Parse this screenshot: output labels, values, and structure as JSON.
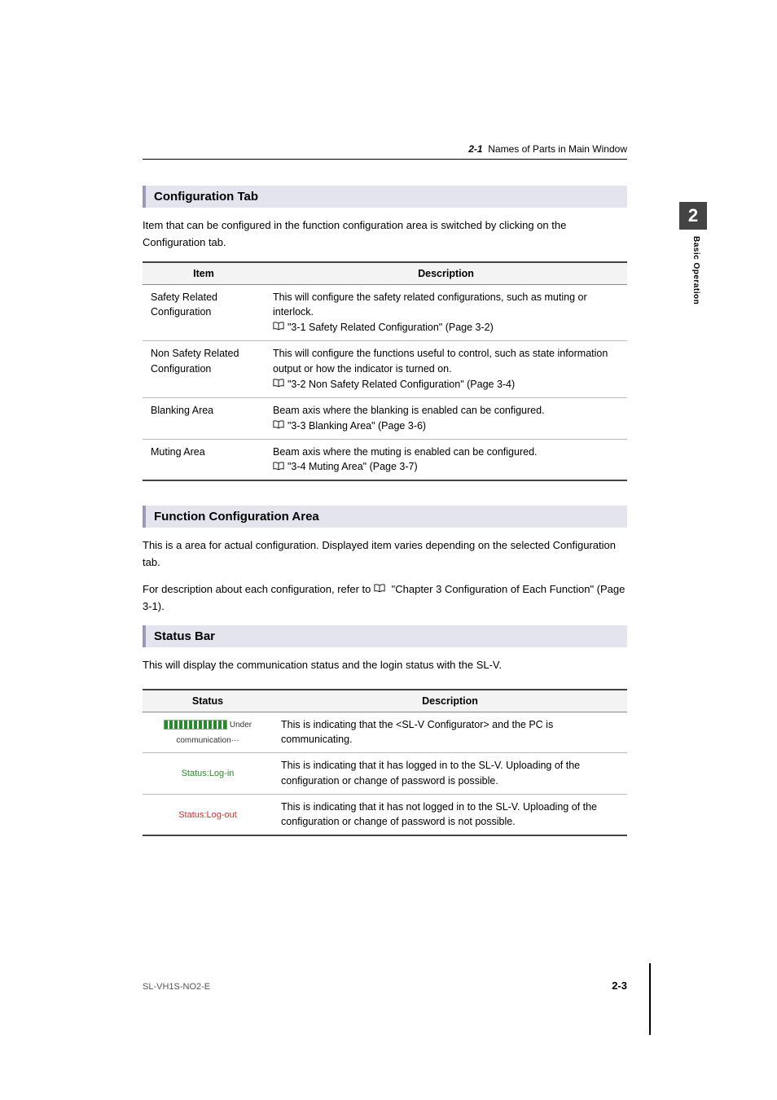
{
  "header": {
    "section_num": "2-1",
    "section_title": "Names of Parts in Main Window"
  },
  "chapter": {
    "number": "2",
    "label": "Basic Operation"
  },
  "sec1": {
    "title": "Configuration Tab",
    "intro": "Item that can be configured in the function configuration area is switched by clicking on the Configuration tab.",
    "th_item": "Item",
    "th_desc": "Description",
    "rows": [
      {
        "item": "Safety Related Configuration",
        "desc": "This will configure the safety related configurations, such as muting or interlock.",
        "ref": "\"3-1 Safety Related Configuration\" (Page 3-2)"
      },
      {
        "item": "Non Safety Related Configuration",
        "desc": "This will configure the functions useful to control, such as state information output or how the indicator is turned on.",
        "ref": "\"3-2 Non Safety Related Configuration\" (Page 3-4)"
      },
      {
        "item": "Blanking Area",
        "desc": "Beam axis where the blanking is enabled can be configured.",
        "ref": "\"3-3 Blanking Area\" (Page 3-6)"
      },
      {
        "item": "Muting Area",
        "desc": "Beam axis where the muting is enabled can be configured.",
        "ref": "\"3-4 Muting Area\" (Page 3-7)"
      }
    ]
  },
  "sec2": {
    "title": "Function Configuration Area",
    "p1": "This is a area for actual configuration. Displayed item varies depending on the selected Configuration tab.",
    "p2a": "For description about each configuration, refer to ",
    "p2b": "\"Chapter 3 Configuration of Each Function\" (Page 3-1)."
  },
  "sec3": {
    "title": "Status Bar",
    "intro": "This will display the communication status and the login status with the SL-V.",
    "th_status": "Status",
    "th_desc": "Description",
    "rows": [
      {
        "status_label": "Under communication···",
        "desc": "This is indicating that the <SL-V Configurator> and the PC is communicating."
      },
      {
        "status_label": "Status:Log-in",
        "desc": "This is indicating that it has logged in to the SL-V. Uploading of the configuration or change of password is possible."
      },
      {
        "status_label": "Status:Log-out",
        "desc": "This is indicating that it has not logged in to the SL-V. Uploading of the configuration or change of password is not possible."
      }
    ]
  },
  "footer": {
    "code": "SL-VH1S-NO2-E",
    "page": "2-3"
  }
}
